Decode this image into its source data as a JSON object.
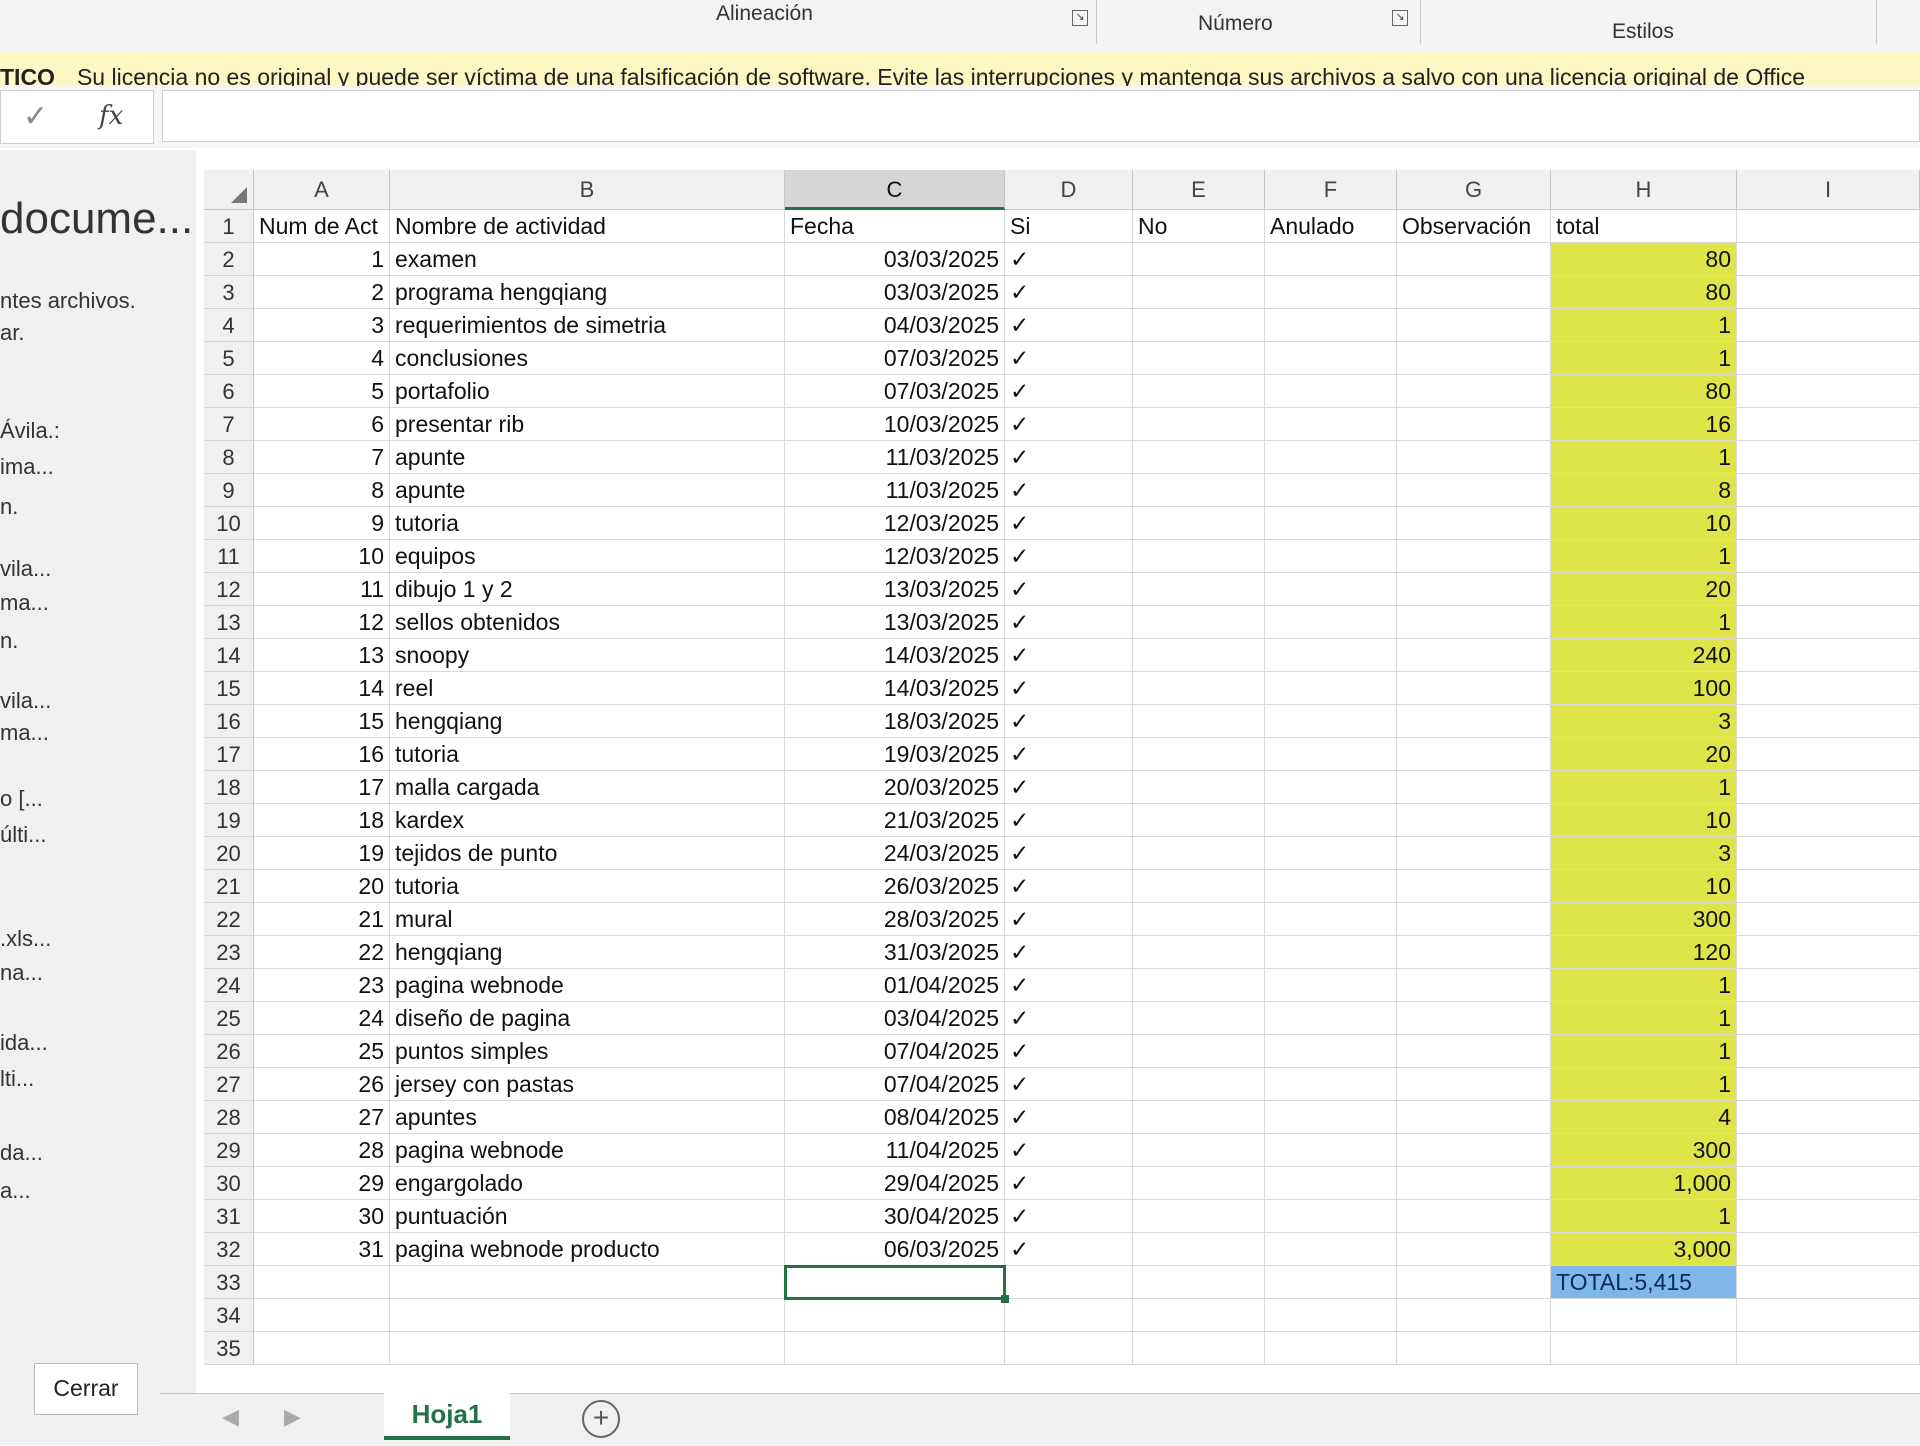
{
  "ribbon": {
    "alignment_label": "Alineación",
    "number_label": "Número",
    "styles_label": "Estilos"
  },
  "warning": {
    "tag": "TICO",
    "message": "Su licencia no es original y puede ser víctima de una falsificación de software. Evite las interrupciones y mantenga sus archivos a salvo con una licencia original de Office"
  },
  "formula_bar": {
    "check_symbol": "✓",
    "fx_symbol": "fx",
    "content": ""
  },
  "left_panel": {
    "title": "docume...",
    "lines": [
      "ntes archivos.",
      "ar.",
      "Ávila.:",
      "ima...",
      "n.",
      "vila...",
      "ma...",
      "n.",
      "vila...",
      "ma...",
      "o [...",
      "últi...",
      ".xls...",
      "na...",
      "ida...",
      "lti...",
      "da...",
      "a..."
    ],
    "close_label": "Cerrar"
  },
  "columns": [
    "A",
    "B",
    "C",
    "D",
    "E",
    "F",
    "G",
    "H",
    "I"
  ],
  "selected_column": "C",
  "headers": {
    "num": "Num de Act",
    "name": "Nombre de actividad",
    "date": "Fecha",
    "si": "Si",
    "no": "No",
    "anulado": "Anulado",
    "obs": "Observación",
    "total": "total"
  },
  "rows": [
    {
      "num": "1",
      "name": "examen",
      "date": "03/03/2025",
      "check": "✓",
      "total": "80"
    },
    {
      "num": "2",
      "name": "programa hengqiang",
      "date": "03/03/2025",
      "check": "✓",
      "total": "80"
    },
    {
      "num": "3",
      "name": "requerimientos de simetria",
      "date": "04/03/2025",
      "check": "✓",
      "total": "1"
    },
    {
      "num": "4",
      "name": "conclusiones",
      "date": "07/03/2025",
      "check": "✓",
      "total": "1"
    },
    {
      "num": "5",
      "name": "portafolio",
      "date": "07/03/2025",
      "check": "✓",
      "total": "80"
    },
    {
      "num": "6",
      "name": "presentar rib",
      "date": "10/03/2025",
      "check": "✓",
      "total": "16"
    },
    {
      "num": "7",
      "name": "apunte",
      "date": "11/03/2025",
      "check": "✓",
      "total": "1"
    },
    {
      "num": "8",
      "name": "apunte",
      "date": "11/03/2025",
      "check": "✓",
      "total": "8"
    },
    {
      "num": "9",
      "name": "tutoria",
      "date": "12/03/2025",
      "check": "✓",
      "total": "10"
    },
    {
      "num": "10",
      "name": "equipos",
      "date": "12/03/2025",
      "check": "✓",
      "total": "1"
    },
    {
      "num": "11",
      "name": "dibujo 1 y 2",
      "date": "13/03/2025",
      "check": "✓",
      "total": "20"
    },
    {
      "num": "12",
      "name": "sellos obtenidos",
      "date": "13/03/2025",
      "check": "✓",
      "total": "1"
    },
    {
      "num": "13",
      "name": "snoopy",
      "date": "14/03/2025",
      "check": "✓",
      "total": "240"
    },
    {
      "num": "14",
      "name": "reel",
      "date": "14/03/2025",
      "check": "✓",
      "total": "100"
    },
    {
      "num": "15",
      "name": "hengqiang",
      "date": "18/03/2025",
      "check": "✓",
      "total": "3"
    },
    {
      "num": "16",
      "name": "tutoria",
      "date": "19/03/2025",
      "check": "✓",
      "total": "20"
    },
    {
      "num": "17",
      "name": "malla cargada",
      "date": "20/03/2025",
      "check": "✓",
      "total": "1"
    },
    {
      "num": "18",
      "name": "kardex",
      "date": "21/03/2025",
      "check": "✓",
      "total": "10"
    },
    {
      "num": "19",
      "name": "tejidos de punto",
      "date": "24/03/2025",
      "check": "✓",
      "total": "3"
    },
    {
      "num": "20",
      "name": "tutoria",
      "date": "26/03/2025",
      "check": "✓",
      "total": "10"
    },
    {
      "num": "21",
      "name": "mural",
      "date": "28/03/2025",
      "check": "✓",
      "total": "300"
    },
    {
      "num": "22",
      "name": "hengqiang",
      "date": "31/03/2025",
      "check": "✓",
      "total": "120"
    },
    {
      "num": "23",
      "name": "pagina webnode",
      "date": "01/04/2025",
      "check": "✓",
      "total": "1"
    },
    {
      "num": "24",
      "name": " diseño de pagina",
      "date": "03/04/2025",
      "check": "✓",
      "total": "1"
    },
    {
      "num": "25",
      "name": "puntos simples",
      "date": "07/04/2025",
      "check": "✓",
      "total": "1"
    },
    {
      "num": "26",
      "name": "jersey con pastas",
      "date": "07/04/2025",
      "check": "✓",
      "total": "1"
    },
    {
      "num": "27",
      "name": "apuntes",
      "date": "08/04/2025",
      "check": "✓",
      "total": "4"
    },
    {
      "num": "28",
      "name": "pagina webnode",
      "date": "11/04/2025",
      "check": "✓",
      "total": "300"
    },
    {
      "num": "29",
      "name": "engargolado",
      "date": "29/04/2025",
      "check": "✓",
      "total": "1,000"
    },
    {
      "num": "30",
      "name": "puntuación",
      "date": "30/04/2025",
      "check": "✓",
      "total": "1"
    },
    {
      "num": "31",
      "name": "pagina webnode producto",
      "date": "06/03/2025",
      "check": "✓",
      "total": "3,000"
    }
  ],
  "grand_total": "TOTAL:5,415",
  "extra_rows": [
    "33",
    "34",
    "35"
  ],
  "sheet_tab": "Hoja1",
  "add_sheet_symbol": "+",
  "nav_prev": "◀",
  "nav_next": "▶",
  "colors": {
    "highlight": "#dfe548",
    "accent": "#217346",
    "total_fill": "#7fb7e8"
  }
}
